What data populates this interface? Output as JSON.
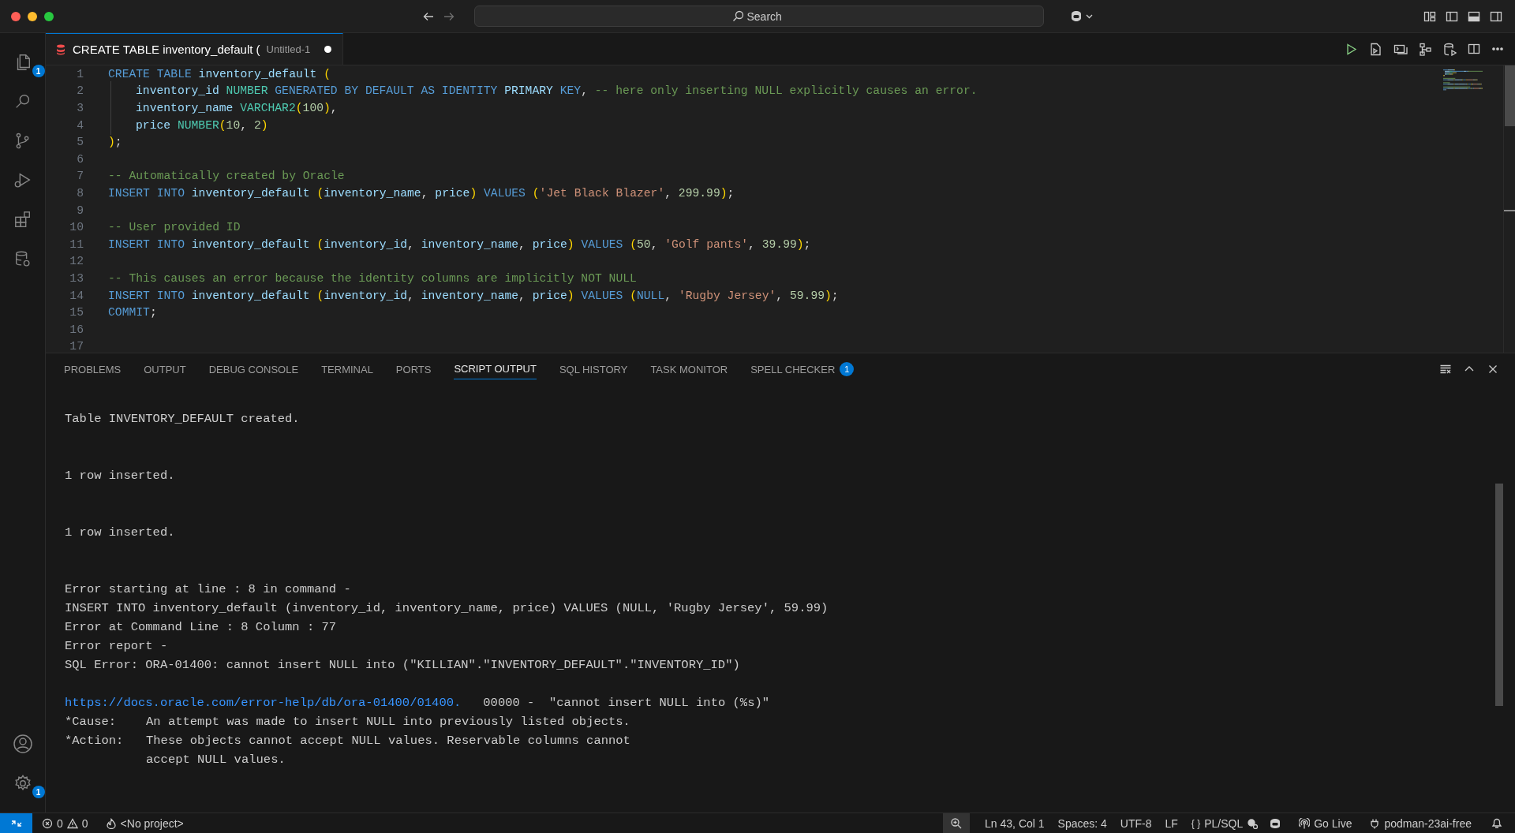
{
  "titlebar": {
    "search": {
      "placeholder": "Search"
    }
  },
  "activity_bar": {
    "explorer_badge": "1",
    "settings_badge": "1"
  },
  "editor_tabs": [
    {
      "title": "CREATE TABLE inventory_default (",
      "description": "Untitled-1",
      "modified": true,
      "selected": true
    }
  ],
  "editor": {
    "lines": [
      {
        "number": "1",
        "indented": false,
        "tokens": [
          {
            "kind": "kw",
            "text": "CREATE TABLE "
          },
          {
            "kind": "id",
            "text": "inventory_default "
          },
          {
            "kind": "paren",
            "text": "("
          }
        ]
      },
      {
        "number": "2",
        "indented": true,
        "tokens": [
          {
            "kind": "id",
            "text": "inventory_id "
          },
          {
            "kind": "type",
            "text": "NUMBER "
          },
          {
            "kind": "kw",
            "text": "GENERATED BY DEFAULT AS IDENTITY "
          },
          {
            "kind": "id",
            "text": "PRIMARY"
          },
          {
            "kind": "kw",
            "text": " KEY"
          },
          {
            "kind": "plain",
            "text": ", "
          },
          {
            "kind": "comment",
            "text": "-- here only inserting NULL explicitly causes an error."
          }
        ]
      },
      {
        "number": "3",
        "indented": true,
        "tokens": [
          {
            "kind": "id",
            "text": "inventory_name "
          },
          {
            "kind": "type",
            "text": "VARCHAR2"
          },
          {
            "kind": "paren",
            "text": "("
          },
          {
            "kind": "num",
            "text": "100"
          },
          {
            "kind": "paren",
            "text": ")"
          },
          {
            "kind": "plain",
            "text": ","
          }
        ]
      },
      {
        "number": "4",
        "indented": true,
        "tokens": [
          {
            "kind": "id",
            "text": "price "
          },
          {
            "kind": "type",
            "text": "NUMBER"
          },
          {
            "kind": "paren",
            "text": "("
          },
          {
            "kind": "num",
            "text": "10"
          },
          {
            "kind": "plain",
            "text": ", "
          },
          {
            "kind": "num",
            "text": "2"
          },
          {
            "kind": "paren",
            "text": ")"
          }
        ]
      },
      {
        "number": "5",
        "indented": false,
        "tokens": [
          {
            "kind": "paren",
            "text": ")"
          },
          {
            "kind": "plain",
            "text": ";"
          }
        ]
      },
      {
        "number": "6"
      },
      {
        "number": "7",
        "indented": false,
        "tokens": [
          {
            "kind": "comment",
            "text": "-- Automatically created by Oracle"
          }
        ]
      },
      {
        "number": "8",
        "indented": false,
        "tokens": [
          {
            "kind": "kw",
            "text": "INSERT INTO "
          },
          {
            "kind": "id",
            "text": "inventory_default "
          },
          {
            "kind": "paren",
            "text": "("
          },
          {
            "kind": "id",
            "text": "inventory_name"
          },
          {
            "kind": "plain",
            "text": ", "
          },
          {
            "kind": "id",
            "text": "price"
          },
          {
            "kind": "paren",
            "text": ")"
          },
          {
            "kind": "kw",
            "text": " VALUES "
          },
          {
            "kind": "paren",
            "text": "("
          },
          {
            "kind": "str",
            "text": "'Jet Black Blazer'"
          },
          {
            "kind": "plain",
            "text": ", "
          },
          {
            "kind": "num",
            "text": "299.99"
          },
          {
            "kind": "paren",
            "text": ")"
          },
          {
            "kind": "plain",
            "text": ";"
          }
        ]
      },
      {
        "number": "9"
      },
      {
        "number": "10",
        "indented": false,
        "tokens": [
          {
            "kind": "comment",
            "text": "-- User provided ID"
          }
        ]
      },
      {
        "number": "11",
        "indented": false,
        "tokens": [
          {
            "kind": "kw",
            "text": "INSERT INTO "
          },
          {
            "kind": "id",
            "text": "inventory_default "
          },
          {
            "kind": "paren",
            "text": "("
          },
          {
            "kind": "id",
            "text": "inventory_id"
          },
          {
            "kind": "plain",
            "text": ", "
          },
          {
            "kind": "id",
            "text": "inventory_name"
          },
          {
            "kind": "plain",
            "text": ", "
          },
          {
            "kind": "id",
            "text": "price"
          },
          {
            "kind": "paren",
            "text": ")"
          },
          {
            "kind": "kw",
            "text": " VALUES "
          },
          {
            "kind": "paren",
            "text": "("
          },
          {
            "kind": "num",
            "text": "50"
          },
          {
            "kind": "plain",
            "text": ", "
          },
          {
            "kind": "str",
            "text": "'Golf pants'"
          },
          {
            "kind": "plain",
            "text": ", "
          },
          {
            "kind": "num",
            "text": "39.99"
          },
          {
            "kind": "paren",
            "text": ")"
          },
          {
            "kind": "plain",
            "text": ";"
          }
        ]
      },
      {
        "number": "12"
      },
      {
        "number": "13",
        "indented": false,
        "tokens": [
          {
            "kind": "comment",
            "text": "-- This causes an error because the identity columns are implicitly NOT NULL"
          }
        ]
      },
      {
        "number": "14",
        "indented": false,
        "tokens": [
          {
            "kind": "kw",
            "text": "INSERT INTO "
          },
          {
            "kind": "id",
            "text": "inventory_default "
          },
          {
            "kind": "paren",
            "text": "("
          },
          {
            "kind": "id",
            "text": "inventory_id"
          },
          {
            "kind": "plain",
            "text": ", "
          },
          {
            "kind": "id",
            "text": "inventory_name"
          },
          {
            "kind": "plain",
            "text": ", "
          },
          {
            "kind": "id",
            "text": "price"
          },
          {
            "kind": "paren",
            "text": ")"
          },
          {
            "kind": "kw",
            "text": " VALUES "
          },
          {
            "kind": "paren",
            "text": "("
          },
          {
            "kind": "kw",
            "text": "NULL"
          },
          {
            "kind": "plain",
            "text": ", "
          },
          {
            "kind": "str",
            "text": "'Rugby Jersey'"
          },
          {
            "kind": "plain",
            "text": ", "
          },
          {
            "kind": "num",
            "text": "59.99"
          },
          {
            "kind": "paren",
            "text": ")"
          },
          {
            "kind": "plain",
            "text": ";"
          }
        ]
      },
      {
        "number": "15",
        "indented": false,
        "tokens": [
          {
            "kind": "kw",
            "text": "COMMIT"
          },
          {
            "kind": "plain",
            "text": ";"
          }
        ]
      },
      {
        "number": "16"
      },
      {
        "number": "17"
      }
    ]
  },
  "panel": {
    "tabs": [
      {
        "label": "PROBLEMS",
        "selected": false
      },
      {
        "label": "OUTPUT",
        "selected": false
      },
      {
        "label": "DEBUG CONSOLE",
        "selected": false
      },
      {
        "label": "TERMINAL",
        "selected": false
      },
      {
        "label": "PORTS",
        "selected": false
      },
      {
        "label": "SCRIPT OUTPUT",
        "selected": true
      },
      {
        "label": "SQL HISTORY",
        "selected": false
      },
      {
        "label": "TASK MONITOR",
        "selected": false
      },
      {
        "label": "SPELL CHECKER",
        "selected": false,
        "badge": "1"
      }
    ],
    "output": [
      [
        {
          "kind": "text",
          "text": "Table INVENTORY_DEFAULT created."
        }
      ],
      [
        {
          "kind": "text",
          "text": "1 row inserted."
        }
      ],
      [
        {
          "kind": "text",
          "text": "1 row inserted."
        }
      ],
      [
        {
          "kind": "text",
          "text": "Error starting at line : 8 in command -"
        },
        {
          "kind": "text",
          "text": "INSERT INTO inventory_default (inventory_id, inventory_name, price) VALUES (NULL, 'Rugby Jersey', 59.99)"
        },
        {
          "kind": "text",
          "text": "Error at Command Line : 8 Column : 77"
        },
        {
          "kind": "text",
          "text": "Error report -"
        },
        {
          "kind": "text",
          "text": "SQL Error: ORA-01400: cannot insert NULL into (\"KILLIAN\".\"INVENTORY_DEFAULT\".\"INVENTORY_ID\")"
        }
      ],
      [
        {
          "kind": "link",
          "link": "https://docs.oracle.com/error-help/db/ora-01400/01400.",
          "text": "00000 -  \"cannot insert NULL into (%s)\""
        },
        {
          "kind": "labeled",
          "label": "*Cause:",
          "lines": [
            "An attempt was made to insert NULL into previously listed objects."
          ]
        },
        {
          "kind": "labeled",
          "label": "*Action:",
          "lines": [
            "These objects cannot accept NULL values. Reservable columns cannot",
            "accept NULL values."
          ]
        }
      ]
    ]
  },
  "status_bar": {
    "errors": "0",
    "warnings": "0",
    "project": "<No project>",
    "cursor": "Ln 43, Col 1",
    "indentation": "Spaces: 4",
    "encoding": "UTF-8",
    "eol": "LF",
    "language_braces": "{ }",
    "language": "PL/SQL",
    "live_server": "Go Live",
    "connection": "podman-23ai-free"
  }
}
